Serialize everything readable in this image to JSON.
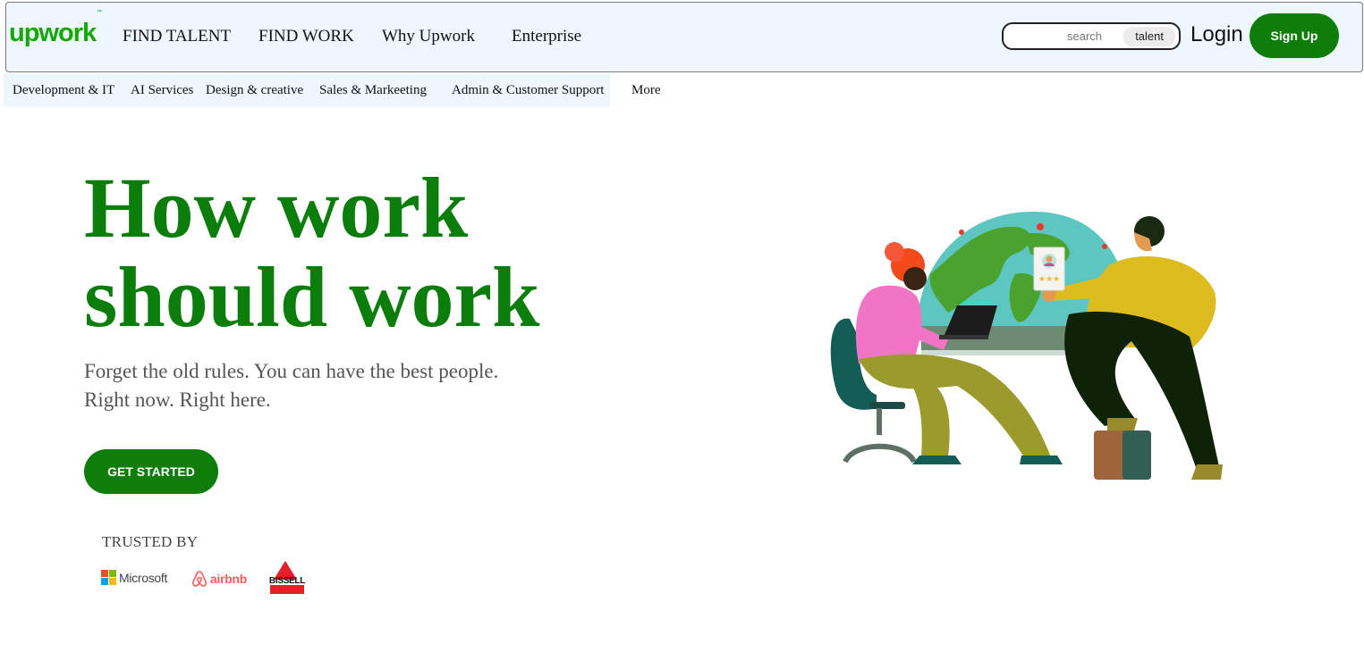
{
  "header": {
    "logo_text": "upwork",
    "logo_mark": "™",
    "nav": [
      {
        "label": "FIND TALENT"
      },
      {
        "label": "FIND WORK"
      },
      {
        "label": "Why Upwork"
      },
      {
        "label": "Enterprise"
      }
    ],
    "search": {
      "placeholder": "search",
      "scope": "talent"
    },
    "login_label": "Login",
    "signup_label": "Sign Up"
  },
  "categories": [
    {
      "label": "Development & IT"
    },
    {
      "label": "AI Services"
    },
    {
      "label": "Design & creative"
    },
    {
      "label": "Sales & Markeeting"
    },
    {
      "label": "Admin & Customer Support"
    },
    {
      "label": "More"
    }
  ],
  "hero": {
    "title_line1": "How work",
    "title_line2": "should work",
    "subtitle_line1": "Forget the old rules. You can have the best people.",
    "subtitle_line2": "Right now. Right here.",
    "cta_label": "GET STARTED"
  },
  "trusted": {
    "heading": "TRUSTED BY",
    "brands": [
      {
        "name": "Microsoft",
        "icon": "microsoft-logo"
      },
      {
        "name": "airbnb",
        "icon": "airbnb-logo"
      },
      {
        "name": "BISSELL",
        "icon": "bissell-logo"
      }
    ]
  },
  "colors": {
    "brand_green": "#14a800",
    "button_green": "#0f7d0a",
    "nav_bg": "#eef6ff",
    "airbnb_red": "#ff5a5f",
    "bissell_red": "#e4202a"
  }
}
